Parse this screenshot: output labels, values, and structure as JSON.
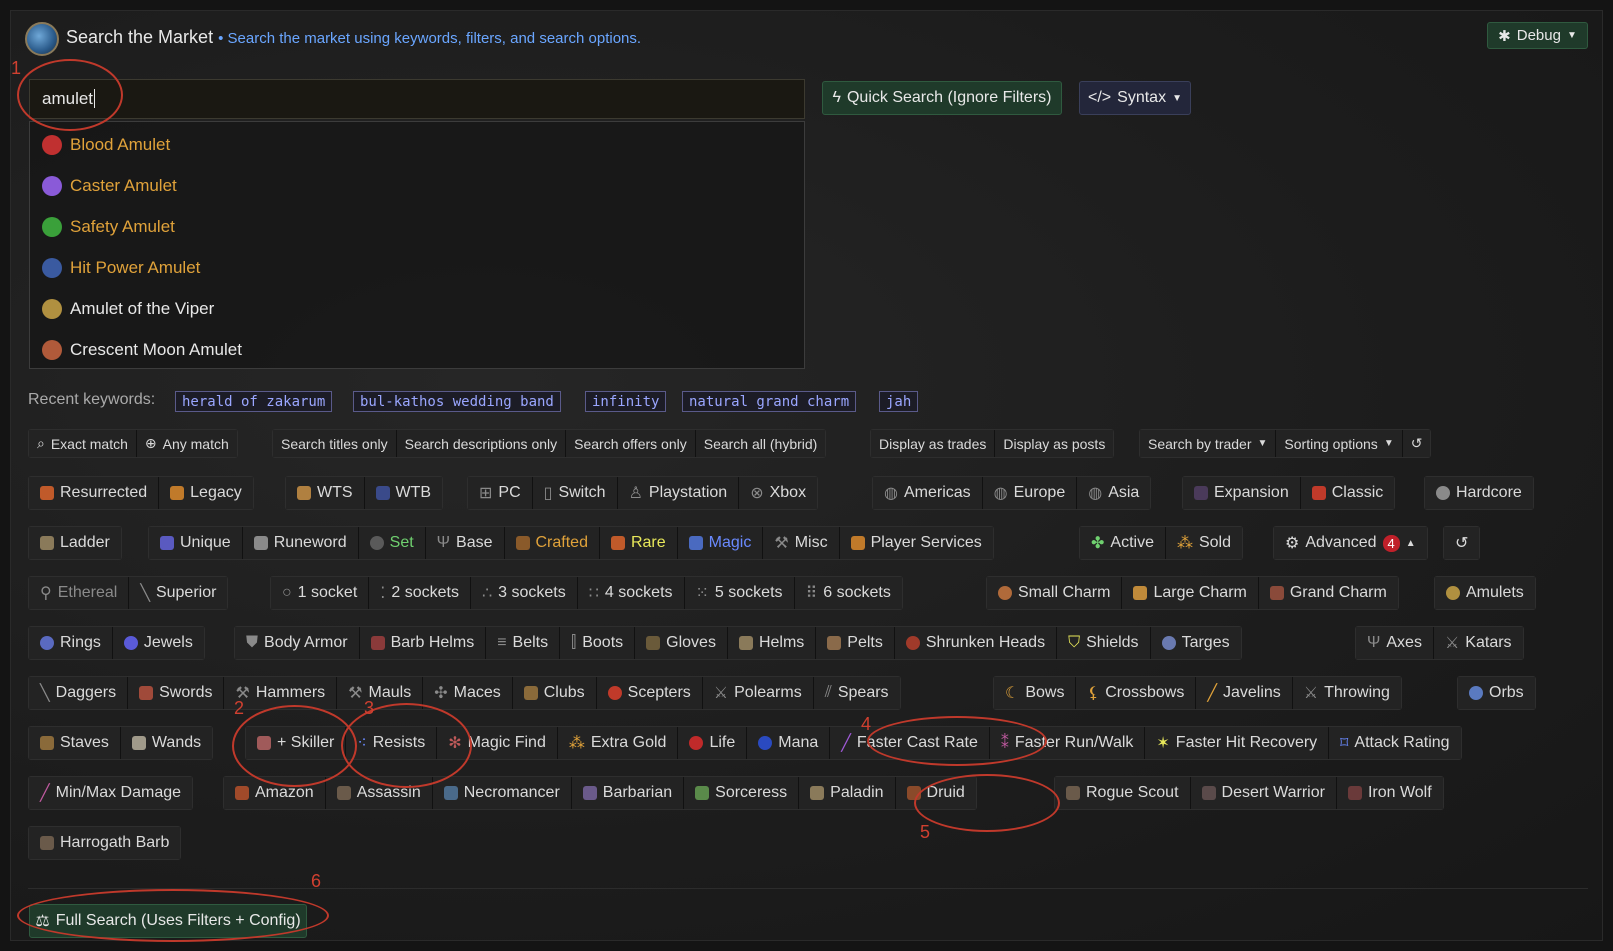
{
  "header": {
    "title": "Search the Market",
    "subtitle": "• Search the market using keywords, filters, and search options.",
    "debug_label": "Debug"
  },
  "search": {
    "value": "amulet",
    "quick_label": "Quick Search (Ignore Filters)",
    "syntax_label": "Syntax"
  },
  "suggestions": [
    {
      "label": "Blood Amulet",
      "rarity": "unique",
      "icon": "amulet-icon",
      "color": "#c03030"
    },
    {
      "label": "Caster Amulet",
      "rarity": "unique",
      "icon": "amulet-icon",
      "color": "#8a5ad8"
    },
    {
      "label": "Safety Amulet",
      "rarity": "unique",
      "icon": "amulet-icon",
      "color": "#3aa03a"
    },
    {
      "label": "Hit Power Amulet",
      "rarity": "unique",
      "icon": "amulet-icon",
      "color": "#3a5aa0"
    },
    {
      "label": "Amulet of the Viper",
      "rarity": "normal",
      "icon": "amulet-icon",
      "color": "#b09040"
    },
    {
      "label": "Crescent Moon Amulet",
      "rarity": "normal",
      "icon": "amulet-icon",
      "color": "#b05a3a"
    }
  ],
  "recent": {
    "label": "Recent keywords:",
    "keywords": [
      "herald of zakarum",
      "bul-kathos wedding band",
      "infinity",
      "natural grand charm",
      "jah"
    ]
  },
  "options": {
    "match": [
      "Exact match",
      "Any match"
    ],
    "scope": [
      "Search titles only",
      "Search descriptions only",
      "Search offers only",
      "Search all (hybrid)"
    ],
    "display": [
      "Display as trades",
      "Display as posts"
    ],
    "by_trader": "Search by trader",
    "sorting": "Sorting options"
  },
  "filters": {
    "edition": [
      "Resurrected",
      "Legacy"
    ],
    "trade_type": [
      "WTS",
      "WTB"
    ],
    "platform": [
      "PC",
      "Switch",
      "Playstation",
      "Xbox"
    ],
    "region": [
      "Americas",
      "Europe",
      "Asia"
    ],
    "expansion": [
      "Expansion",
      "Classic"
    ],
    "hardcore": "Hardcore",
    "ladder": "Ladder",
    "quality": [
      "Unique",
      "Runeword",
      "Set",
      "Base",
      "Crafted",
      "Rare",
      "Magic",
      "Misc",
      "Player Services"
    ],
    "status": [
      "Active",
      "Sold"
    ],
    "advanced": "Advanced",
    "advanced_count": "4",
    "eth": [
      "Ethereal",
      "Superior"
    ],
    "sockets": [
      "1 socket",
      "2 sockets",
      "3 sockets",
      "4 sockets",
      "5 sockets",
      "6 sockets"
    ],
    "charms": [
      "Small Charm",
      "Large Charm",
      "Grand Charm"
    ],
    "amulets": "Amulets",
    "row5a": [
      "Rings",
      "Jewels"
    ],
    "row5b": [
      "Body Armor",
      "Barb Helms",
      "Belts",
      "Boots",
      "Gloves",
      "Helms",
      "Pelts",
      "Shrunken Heads",
      "Shields",
      "Targes"
    ],
    "row5c": [
      "Axes",
      "Katars"
    ],
    "row6a": [
      "Daggers",
      "Swords",
      "Hammers",
      "Mauls",
      "Maces",
      "Clubs",
      "Scepters",
      "Polearms",
      "Spears"
    ],
    "row6b": [
      "Bows",
      "Crossbows",
      "Javelins",
      "Throwing"
    ],
    "orbs": "Orbs",
    "row7a": [
      "Staves",
      "Wands"
    ],
    "row7b": [
      "+ Skiller",
      "Resists",
      "Magic Find",
      "Extra Gold",
      "Life",
      "Mana",
      "Faster Cast Rate",
      "Faster Run/Walk",
      "Faster Hit Recovery",
      "Attack Rating"
    ],
    "minmax": "Min/Max Damage",
    "classes": [
      "Amazon",
      "Assassin",
      "Necromancer",
      "Barbarian",
      "Sorceress",
      "Paladin",
      "Druid"
    ],
    "mercs": [
      "Rogue Scout",
      "Desert Warrior",
      "Iron Wolf"
    ],
    "harrogath": "Harrogath Barb"
  },
  "full_search_label": "Full Search (Uses Filters + Config)",
  "annotations": [
    "1",
    "2",
    "3",
    "4",
    "5",
    "6"
  ]
}
